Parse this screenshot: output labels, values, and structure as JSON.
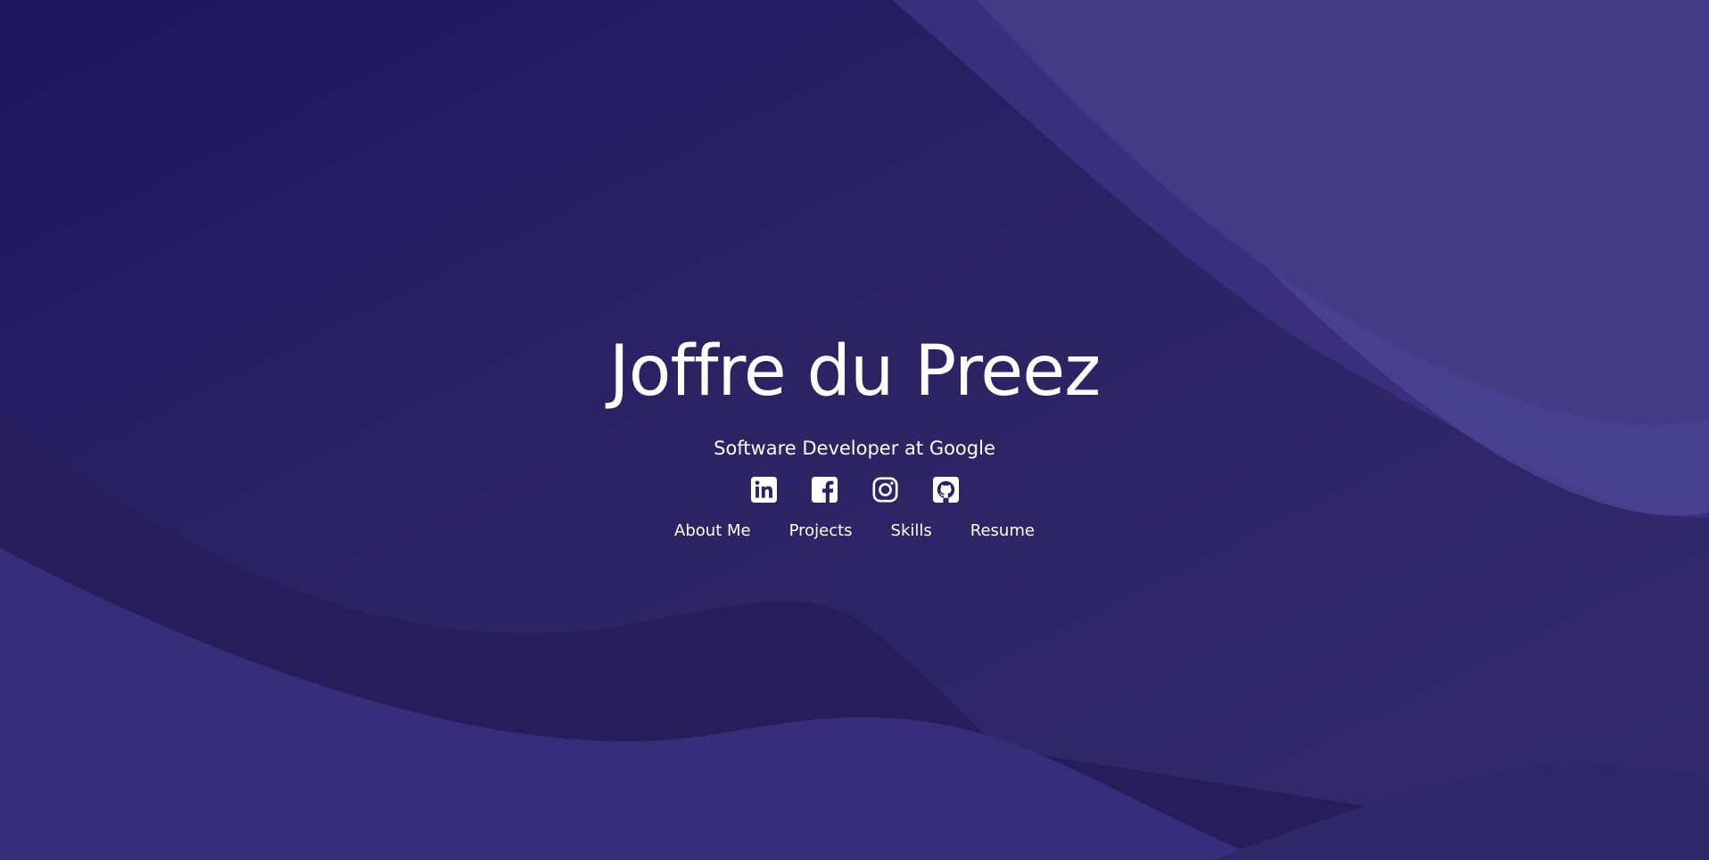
{
  "hero": {
    "name": "Joffre du Preez",
    "subtitle": "Software Developer at Google"
  },
  "social_links": [
    {
      "icon": "linkedin-icon"
    },
    {
      "icon": "facebook-icon"
    },
    {
      "icon": "instagram-icon"
    },
    {
      "icon": "github-icon"
    }
  ],
  "nav": {
    "items": [
      {
        "label": "About Me"
      },
      {
        "label": "Projects"
      },
      {
        "label": "Skills"
      },
      {
        "label": "Resume"
      }
    ]
  },
  "colors": {
    "background_base": "#241b5e",
    "background_light": "#433c85",
    "text": "#ffffff"
  }
}
